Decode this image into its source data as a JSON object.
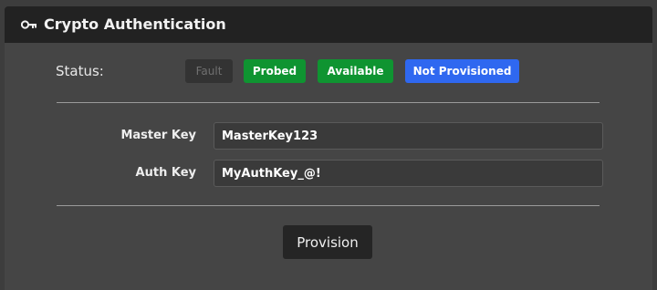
{
  "header": {
    "title": "Crypto Authentication",
    "icon": "key-icon"
  },
  "status": {
    "label": "Status:",
    "badges": [
      {
        "text": "Fault",
        "color": "#333333",
        "active": false
      },
      {
        "text": "Probed",
        "color": "#0f9431",
        "active": true
      },
      {
        "text": "Available",
        "color": "#0f9431",
        "active": true
      },
      {
        "text": "Not Provisioned",
        "color": "#2f68f0",
        "active": true
      }
    ]
  },
  "form": {
    "master_key": {
      "label": "Master Key",
      "value": "MasterKey123"
    },
    "auth_key": {
      "label": "Auth Key",
      "value": "MyAuthKey_@!"
    }
  },
  "actions": {
    "provision_label": "Provision"
  }
}
